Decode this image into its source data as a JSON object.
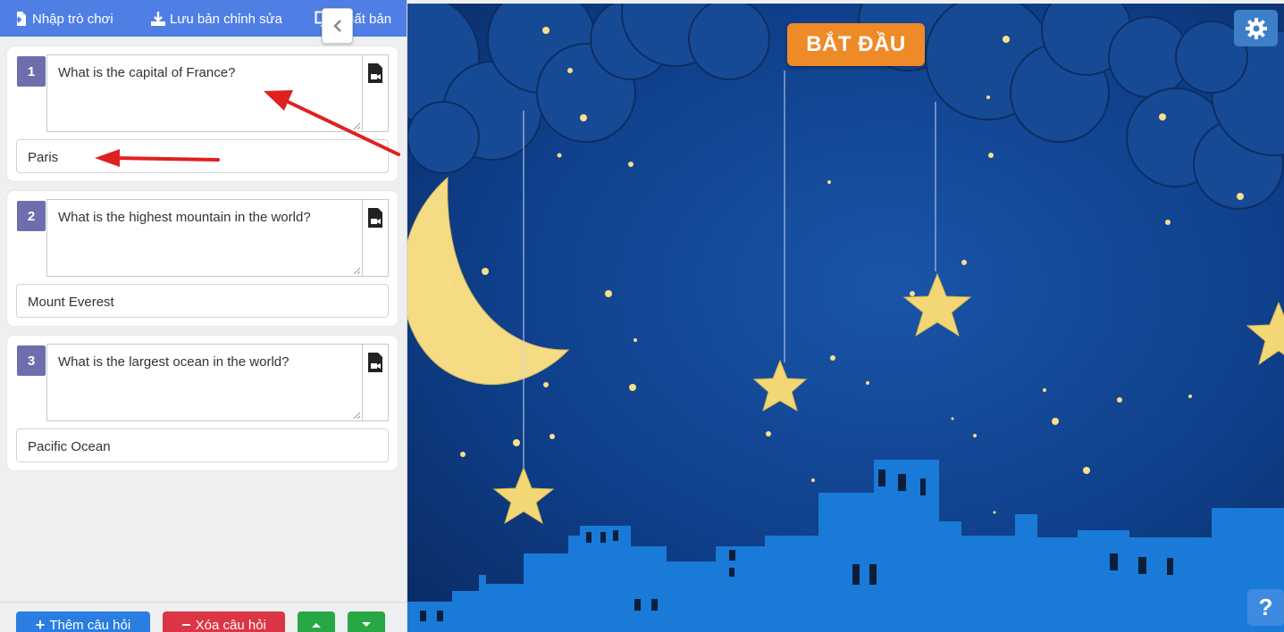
{
  "toolbar": {
    "import_label": "Nhập trò chơi",
    "save_label": "Lưu bản chỉnh sửa",
    "publish_label": "Xuất bản"
  },
  "questions": [
    {
      "number": "1",
      "text": "What is the capital of France?",
      "answer": "Paris"
    },
    {
      "number": "2",
      "text": "What is the highest mountain in the world?",
      "answer": "Mount Everest"
    },
    {
      "number": "3",
      "text": "What is the largest ocean in the world?",
      "answer": "Pacific Ocean"
    }
  ],
  "bottom_bar": {
    "add_label": "Thêm câu hỏi",
    "delete_label": "Xóa câu hỏi"
  },
  "stage": {
    "start_label": "BẮT ĐẦU",
    "help_label": "?"
  },
  "colors": {
    "toolbar": "#4f7fe5",
    "question_badge": "#6e6eae",
    "add_button": "#2a7de1",
    "delete_button": "#dc3545",
    "move_button": "#28a745",
    "start_button": "#ef8a28",
    "night_sky": "#0d3e8c",
    "annotation_arrow": "#e02020"
  }
}
